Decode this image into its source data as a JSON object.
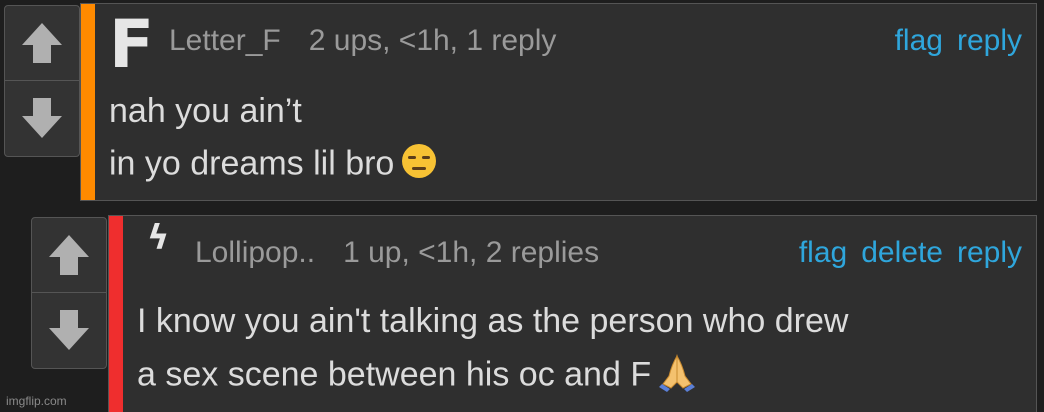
{
  "colors": {
    "background": "#1e1e1e",
    "panel": "#2f2f2f",
    "accent_comment_1": "#ff8a00",
    "accent_comment_2": "#ef2e2e",
    "link": "#2fa6dc",
    "meta_text": "#9a9a9a",
    "body_text": "#dcdcdc"
  },
  "comments": [
    {
      "avatar": "F",
      "username": "Letter_F",
      "meta": "2 ups, <1h, 1 reply",
      "actions": [
        "flag",
        "reply"
      ],
      "body": [
        "nah you ain’t",
        "in yo dreams lil bro"
      ],
      "emoji": "expressionless-face"
    },
    {
      "avatar": "ϟ",
      "username": "Lollipop..",
      "meta": "1 up, <1h, 2 replies",
      "actions": [
        "flag",
        "delete",
        "reply"
      ],
      "body": [
        "I know you ain't talking as the person who drew",
        "a sex scene between his oc and F"
      ],
      "emoji": "folded-hands"
    }
  ],
  "icons": {
    "upvote": "up-arrow-icon",
    "downvote": "down-arrow-icon"
  },
  "watermark": "imgflip.com"
}
